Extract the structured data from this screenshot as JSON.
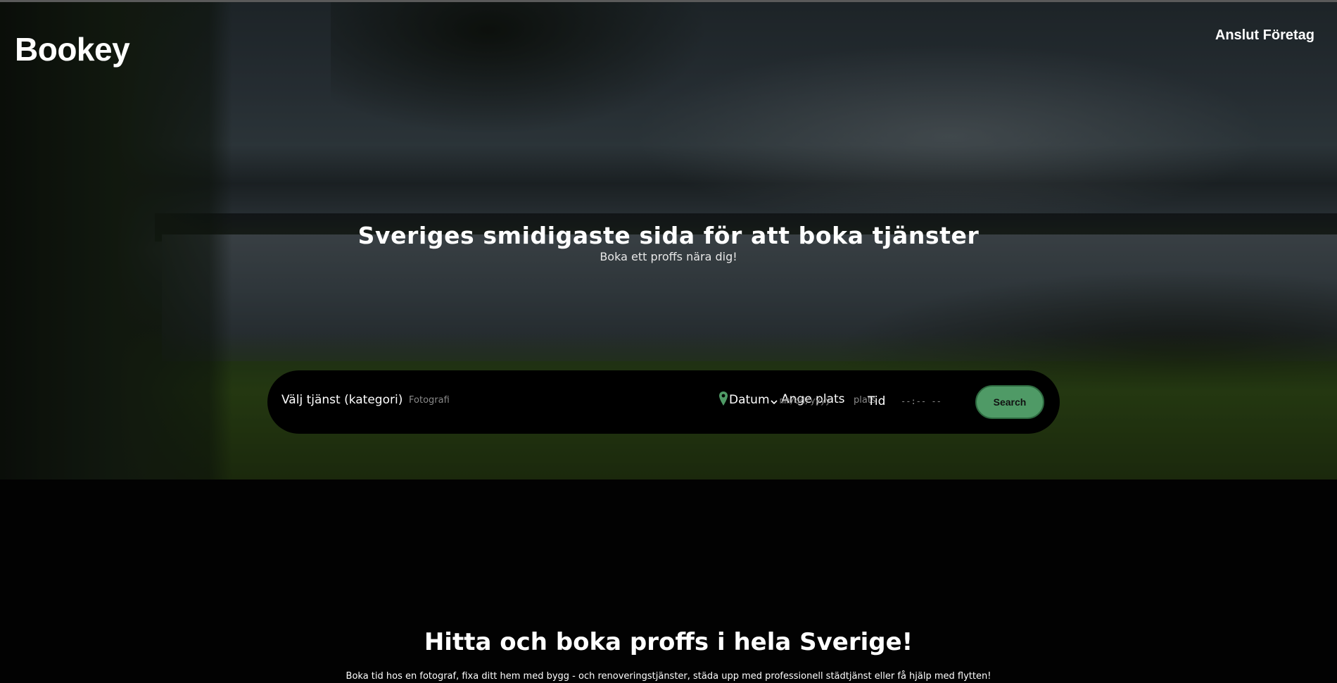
{
  "header": {
    "logo": "Bookey",
    "nav_link": "Anslut Företag"
  },
  "hero": {
    "title": "Sveriges smidigaste sida för att boka tjänster",
    "subtitle": "Boka ett proffs nära dig!"
  },
  "search": {
    "service_label": "Välj tjänst (kategori)",
    "service_placeholder": "Fotografi",
    "location_label": "Ange plats",
    "location_placeholder": "plats",
    "date_label": "Datum",
    "date_placeholder": "mm/dd/yyyy",
    "time_label": "Tid",
    "time_placeholder": "--:-- --",
    "button_label": "Search",
    "icons": {
      "dropdown": "chevron-down-icon",
      "location": "map-pin-icon"
    },
    "colors": {
      "button": "#4f9a66",
      "pin": "#4f9a66"
    }
  },
  "section": {
    "title": "Hitta och boka proffs i hela Sverige!",
    "text": "Boka tid hos en fotograf, fixa ditt hem med bygg - och renoveringstjänster, städa upp med professionell städtjänst eller få hjälp med flytten!"
  }
}
